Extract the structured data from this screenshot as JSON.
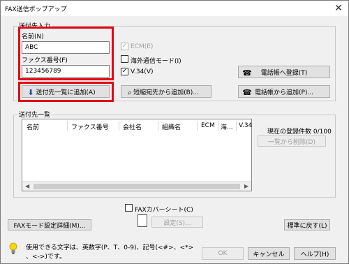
{
  "window": {
    "title": "FAX送信ポップアップ",
    "close": "✕"
  },
  "destination_input": {
    "group_label": "送付先入力",
    "name_label": "名前(N)",
    "name_value": "ABC",
    "fax_label": "ファクス番号(F)",
    "fax_value": "123456789",
    "ecm_label": "ECM(E)",
    "overseas_label": "海外通信モード(I)",
    "v34_label": "V.34(V)",
    "register_phonebook": "電話帳へ登録(T)",
    "add_to_list": "送付先一覧に追加(A)",
    "add_from_speed_dial": "短縮宛先から追加(B)...",
    "add_from_phonebook": "電話帳から追加(P)..."
  },
  "destination_list": {
    "group_label": "送付先一覧",
    "columns": [
      "名前",
      "ファクス番号",
      "会社名",
      "組織名",
      "ECM",
      "海...",
      "V.34"
    ],
    "count_label": "現在の登録件数 0/100",
    "delete_button": "一覧から削除(D)"
  },
  "fax_cover": {
    "checkbox_label": "FAXカバーシート(C)",
    "settings_button": "設定(S)..."
  },
  "buttons": {
    "fax_mode_details": "FAXモード設定詳細(M)...",
    "default": "標準に戻す(L)",
    "ok": "OK",
    "cancel": "キャンセル",
    "help": "ヘルプ(H)"
  },
  "tip": {
    "line1": "使用できる文字は、英数字(P、T、0-9)、記号(<#>、<*>",
    "line2": "、<->)です。"
  }
}
